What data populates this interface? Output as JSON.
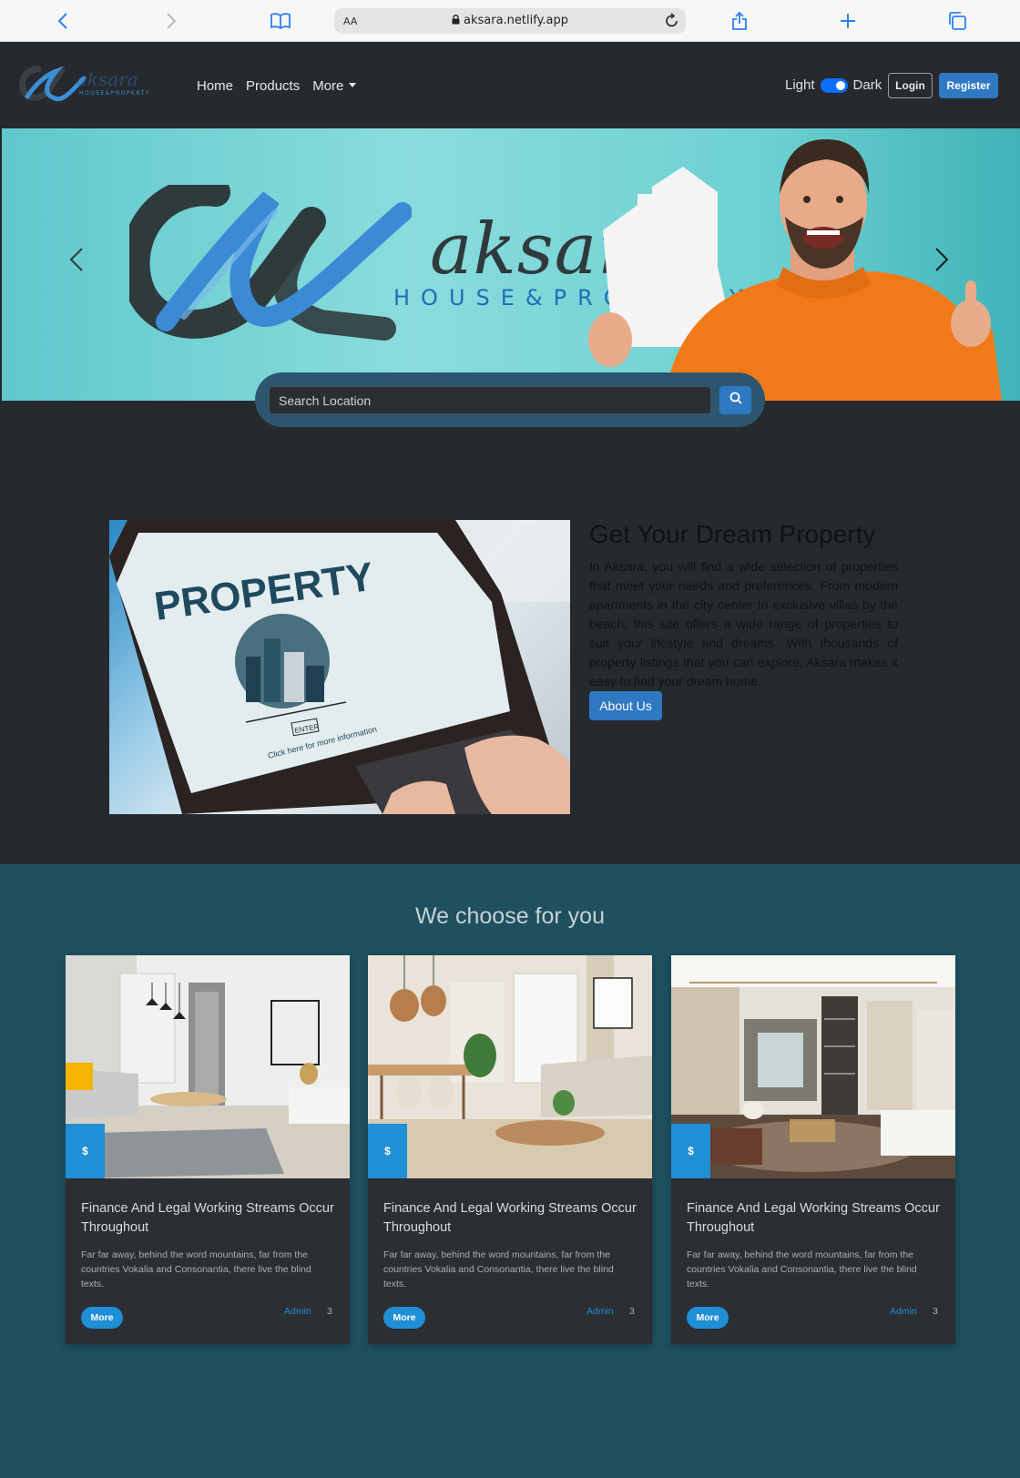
{
  "browser": {
    "text_size_label": "AA",
    "url": "aksara.netlify.app"
  },
  "navbar": {
    "logo_text": "aksara",
    "logo_subtext": "HOUSE&PROPERTY",
    "links": [
      "Home",
      "Products",
      "More"
    ],
    "theme_light_label": "Light",
    "theme_dark_label": "Dark",
    "theme_dark_enabled": true,
    "login_label": "Login",
    "register_label": "Register"
  },
  "hero": {
    "brand_word": "aksara",
    "brand_sub": "HOUSE&PROPERTY"
  },
  "search": {
    "placeholder": "Search Location"
  },
  "about": {
    "image_text": "PROPERTY",
    "image_enter": "ENTER",
    "image_caption": "Click here for more information",
    "title": "Get Your Dream Property",
    "text": "In Aksara, you will find a wide selection of properties that meet your needs and preferences. From modern apartments in the city center to exclusive villas by the beach, this site offers a wide range of properties to suit your lifestyle and dreams. With thousands of property listings that you can explore, Aksara makes it easy to find your dream home.",
    "button_label": "About Us"
  },
  "featured": {
    "title": "We choose for you",
    "cards": [
      {
        "price": "$",
        "title": "Finance And Legal Working Streams Occur Throughout",
        "text": "Far far away, behind the word mountains, far from the countries Vokalia and Consonantia, there live the blind texts.",
        "button": "More",
        "author": "Admin",
        "count": "3"
      },
      {
        "price": "$",
        "title": "Finance And Legal Working Streams Occur Throughout",
        "text": "Far far away, behind the word mountains, far from the countries Vokalia and Consonantia, there live the blind texts.",
        "button": "More",
        "author": "Admin",
        "count": "3"
      },
      {
        "price": "$",
        "title": "Finance And Legal Working Streams Occur Throughout",
        "text": "Far far away, behind the word mountains, far from the countries Vokalia and Consonantia, there live the blind texts.",
        "button": "More",
        "author": "Admin",
        "count": "3"
      }
    ]
  },
  "colors": {
    "navbar_bg": "#262a2f",
    "accent_blue": "#2f78c2",
    "card_accent": "#1f8fd6",
    "teal_section": "#1e5060"
  }
}
